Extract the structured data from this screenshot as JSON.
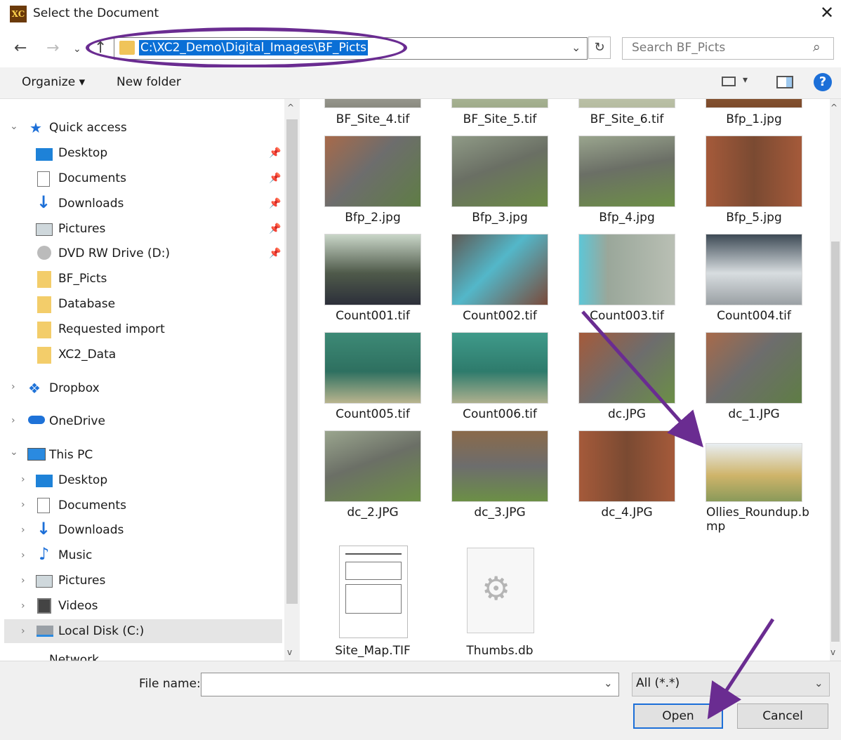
{
  "window": {
    "title": "Select the Document",
    "app_icon": "XC"
  },
  "nav": {
    "back_icon": "arrow-left-icon",
    "address": "C:\\XC2_Demo\\Digital_Images\\BF_Picts",
    "search_placeholder": "Search BF_Picts"
  },
  "toolbar": {
    "organize": "Organize ▾",
    "new_folder": "New folder",
    "help": "?"
  },
  "sidebar": {
    "quick_access": "Quick access",
    "qa_items": [
      {
        "label": "Desktop"
      },
      {
        "label": "Documents"
      },
      {
        "label": "Downloads"
      },
      {
        "label": "Pictures"
      },
      {
        "label": "DVD RW Drive (D:)"
      },
      {
        "label": "BF_Picts"
      },
      {
        "label": "Database"
      },
      {
        "label": "Requested import"
      },
      {
        "label": "XC2_Data"
      }
    ],
    "dropbox": "Dropbox",
    "onedrive": "OneDrive",
    "this_pc": "This PC",
    "pc_items": [
      {
        "label": "Desktop"
      },
      {
        "label": "Documents"
      },
      {
        "label": "Downloads"
      },
      {
        "label": "Music"
      },
      {
        "label": "Pictures"
      },
      {
        "label": "Videos"
      },
      {
        "label": "Local Disk (C:)"
      }
    ],
    "network_partial": "Network"
  },
  "files": [
    "BF_Site_4.tif",
    "BF_Site_5.tif",
    "BF_Site_6.tif",
    "Bfp_1.jpg",
    "Bfp_2.jpg",
    "Bfp_3.jpg",
    "Bfp_4.jpg",
    "Bfp_5.jpg",
    "Count001.tif",
    "Count002.tif",
    "Count003.tif",
    "Count004.tif",
    "Count005.tif",
    "Count006.tif",
    "dc.JPG",
    "dc_1.JPG",
    "dc_2.JPG",
    "dc_3.JPG",
    "dc_4.JPG",
    "Ollies_Roundup.bmp",
    "Site_Map.TIF",
    "Thumbs.db"
  ],
  "filename_wrap": {
    "line1": "Ollies_Roundup.b",
    "line2": "mp"
  },
  "bottom": {
    "file_name_label": "File name:",
    "file_name_value": "",
    "filter": "All (*.*)",
    "open": "Open",
    "cancel": "Cancel"
  },
  "annotation_color": "#6a2c91",
  "accent": "#0a6fd6"
}
